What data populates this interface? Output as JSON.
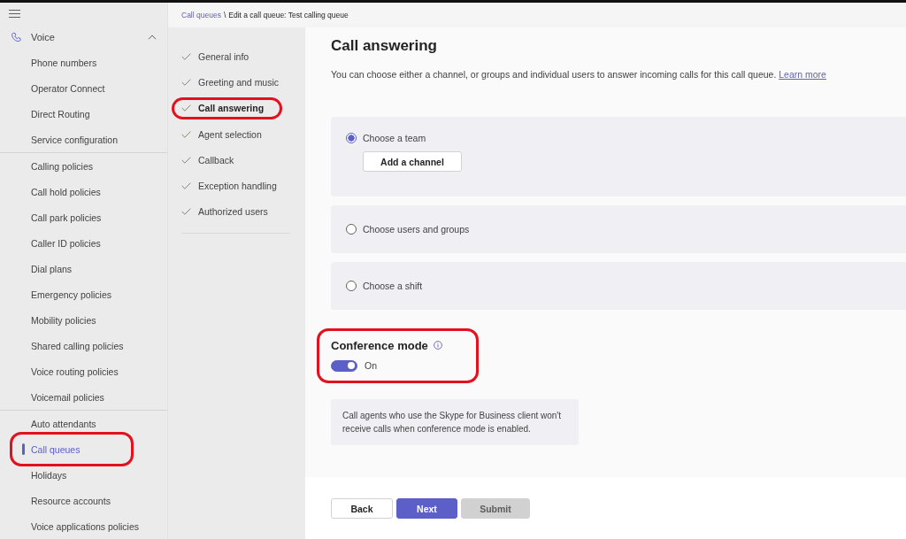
{
  "sidebar": {
    "section": {
      "label": "Voice",
      "expanded": true
    },
    "groups": [
      {
        "items": [
          {
            "label": "Phone numbers",
            "selected": false,
            "highlighted": false
          },
          {
            "label": "Operator Connect",
            "selected": false,
            "highlighted": false
          },
          {
            "label": "Direct Routing",
            "selected": false,
            "highlighted": false
          },
          {
            "label": "Service configuration",
            "selected": false,
            "highlighted": false
          }
        ]
      },
      {
        "items": [
          {
            "label": "Calling policies",
            "selected": false,
            "highlighted": false
          },
          {
            "label": "Call hold policies",
            "selected": false,
            "highlighted": false
          },
          {
            "label": "Call park policies",
            "selected": false,
            "highlighted": false
          },
          {
            "label": "Caller ID policies",
            "selected": false,
            "highlighted": false
          },
          {
            "label": "Dial plans",
            "selected": false,
            "highlighted": false
          },
          {
            "label": "Emergency policies",
            "selected": false,
            "highlighted": false
          },
          {
            "label": "Mobility policies",
            "selected": false,
            "highlighted": false
          },
          {
            "label": "Shared calling policies",
            "selected": false,
            "highlighted": false
          },
          {
            "label": "Voice routing policies",
            "selected": false,
            "highlighted": false
          },
          {
            "label": "Voicemail policies",
            "selected": false,
            "highlighted": false
          }
        ]
      },
      {
        "items": [
          {
            "label": "Auto attendants",
            "selected": false,
            "highlighted": false
          },
          {
            "label": "Call queues",
            "selected": true,
            "highlighted": true
          },
          {
            "label": "Holidays",
            "selected": false,
            "highlighted": false
          },
          {
            "label": "Resource accounts",
            "selected": false,
            "highlighted": false
          },
          {
            "label": "Voice applications policies",
            "selected": false,
            "highlighted": false
          }
        ]
      }
    ]
  },
  "breadcrumb": {
    "link": "Call queues",
    "separator": "\\",
    "current": "Edit a call queue: Test calling queue"
  },
  "steps": [
    {
      "label": "General info",
      "completed": true,
      "selected": false,
      "highlighted": false
    },
    {
      "label": "Greeting and music",
      "completed": true,
      "selected": false,
      "highlighted": false
    },
    {
      "label": "Call answering",
      "completed": true,
      "selected": true,
      "highlighted": true
    },
    {
      "label": "Agent selection",
      "completed": true,
      "selected": false,
      "highlighted": false
    },
    {
      "label": "Callback",
      "completed": true,
      "selected": false,
      "highlighted": false
    },
    {
      "label": "Exception handling",
      "completed": true,
      "selected": false,
      "highlighted": false
    },
    {
      "label": "Authorized users",
      "completed": true,
      "selected": false,
      "highlighted": false
    }
  ],
  "page": {
    "title": "Call answering",
    "description": "You can choose either a channel, or groups and individual users to answer incoming calls for this call queue.",
    "link": "Learn more"
  },
  "options": [
    {
      "label": "Choose a team",
      "selected": true,
      "action": "Add a channel"
    },
    {
      "label": "Choose users and groups",
      "selected": false
    },
    {
      "label": "Choose a shift",
      "selected": false
    }
  ],
  "conference_mode": {
    "title": "Conference mode",
    "highlighted": true,
    "toggle": {
      "on": true,
      "label": "On"
    },
    "note": "Call agents who use the Skype for Business client won't receive calls when conference mode is enabled."
  },
  "buttons": [
    {
      "label": "Back",
      "kind": "secondary",
      "disabled": false
    },
    {
      "label": "Next",
      "kind": "primary",
      "disabled": false
    },
    {
      "label": "Submit",
      "kind": "primary",
      "disabled": true
    }
  ]
}
